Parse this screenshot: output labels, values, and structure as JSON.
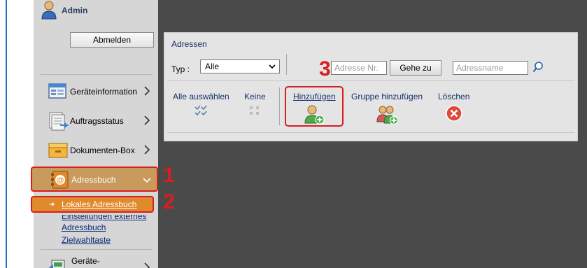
{
  "sidebar": {
    "user_name": "Admin",
    "logout_label": "Abmelden",
    "nav": [
      {
        "label": "Geräteinformation"
      },
      {
        "label": "Auftragsstatus"
      },
      {
        "label": "Dokumenten-Box"
      },
      {
        "label": "Adressbuch"
      },
      {
        "label": "Geräte-"
      }
    ],
    "sub_active": "Lokales Adressbuch",
    "sub_links": [
      "Einstellungen externes",
      "Adressbuch",
      "Zielwahltaste"
    ]
  },
  "panel": {
    "title": "Adressen",
    "typ_label": "Typ :",
    "typ_value": "Alle",
    "address_number_placeholder": "Adresse Nr.",
    "goto_label": "Gehe zu",
    "address_name_placeholder": "Adressname",
    "tools": {
      "select_all": "Alle auswählen",
      "none": "Keine",
      "add": "Hinzufügen",
      "add_group": "Gruppe hinzufügen",
      "delete": "Löschen"
    }
  },
  "callouts": [
    "1",
    "2",
    "3"
  ],
  "colors": {
    "highlight": "#d81e1e",
    "active_nav": "#c89a5c",
    "active_sub": "#e08a2e",
    "sidebar_bg": "#d6d6d6",
    "main_bg": "#4a4a4a",
    "link": "#17306a"
  },
  "icons": [
    "user-icon",
    "device-info-icon",
    "job-status-icon",
    "document-box-icon",
    "address-book-icon",
    "device-icon",
    "search-icon",
    "select-all-icon",
    "deselect-icon",
    "add-contact-icon",
    "add-group-icon",
    "delete-icon"
  ]
}
